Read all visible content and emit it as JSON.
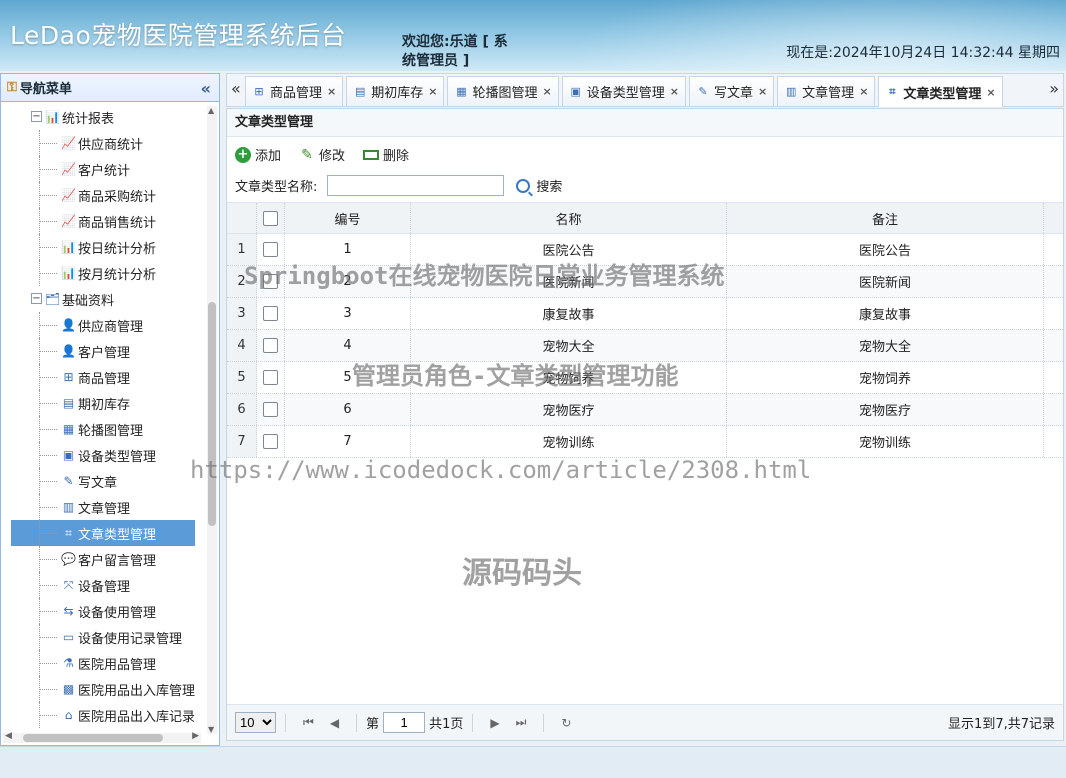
{
  "header": {
    "app_title": "LeDao宠物医院管理系统后台",
    "welcome": "欢迎您:乐道 [ 系统管理员 ]",
    "clock": "现在是:2024年10月24日 14:32:44 星期四"
  },
  "sidebar": {
    "title": "导航菜单",
    "collapse_glyph": "«",
    "items": [
      {
        "type": "group",
        "label": "统计报表",
        "icon": "chart-icon"
      },
      {
        "type": "leaf",
        "label": "供应商统计",
        "icon": "chart-page-icon"
      },
      {
        "type": "leaf",
        "label": "客户统计",
        "icon": "chart-page-icon"
      },
      {
        "type": "leaf",
        "label": "商品采购统计",
        "icon": "chart-page-icon"
      },
      {
        "type": "leaf",
        "label": "商品销售统计",
        "icon": "chart-page-icon"
      },
      {
        "type": "leaf",
        "label": "按日统计分析",
        "icon": "bar-chart-icon"
      },
      {
        "type": "leaf",
        "label": "按月统计分析",
        "icon": "bar-chart-icon"
      },
      {
        "type": "group",
        "label": "基础资料",
        "icon": "folder-icon"
      },
      {
        "type": "leaf",
        "label": "供应商管理",
        "icon": "user-icon"
      },
      {
        "type": "leaf",
        "label": "客户管理",
        "icon": "user-icon"
      },
      {
        "type": "leaf",
        "label": "商品管理",
        "icon": "hierarchy-icon"
      },
      {
        "type": "leaf",
        "label": "期初库存",
        "icon": "inventory-icon"
      },
      {
        "type": "leaf",
        "label": "轮播图管理",
        "icon": "carousel-icon"
      },
      {
        "type": "leaf",
        "label": "设备类型管理",
        "icon": "chip-icon"
      },
      {
        "type": "leaf",
        "label": "写文章",
        "icon": "write-icon"
      },
      {
        "type": "leaf",
        "label": "文章管理",
        "icon": "document-icon"
      },
      {
        "type": "leaf",
        "label": "文章类型管理",
        "icon": "crop-icon",
        "selected": true
      },
      {
        "type": "leaf",
        "label": "客户留言管理",
        "icon": "comment-icon"
      },
      {
        "type": "leaf",
        "label": "设备管理",
        "icon": "expand-icon"
      },
      {
        "type": "leaf",
        "label": "设备使用管理",
        "icon": "flow-icon"
      },
      {
        "type": "leaf",
        "label": "设备使用记录管理",
        "icon": "monitor-icon"
      },
      {
        "type": "leaf",
        "label": "医院用品管理",
        "icon": "flask-icon"
      },
      {
        "type": "leaf",
        "label": "医院用品出入库管理",
        "icon": "grid-icon"
      },
      {
        "type": "leaf",
        "label": "医院用品出入库记录",
        "icon": "building-icon"
      }
    ]
  },
  "tabs": [
    {
      "label": "商品管理",
      "icon": "hierarchy-icon"
    },
    {
      "label": "期初库存",
      "icon": "inventory-icon"
    },
    {
      "label": "轮播图管理",
      "icon": "carousel-icon"
    },
    {
      "label": "设备类型管理",
      "icon": "chip-icon"
    },
    {
      "label": "写文章",
      "icon": "write-icon"
    },
    {
      "label": "文章管理",
      "icon": "document-icon"
    },
    {
      "label": "文章类型管理",
      "icon": "crop-icon",
      "active": true
    }
  ],
  "panel": {
    "title": "文章类型管理",
    "toolbar": {
      "add": "添加",
      "edit": "修改",
      "delete": "删除"
    },
    "search": {
      "label": "文章类型名称:",
      "value": "",
      "button": "搜索"
    },
    "columns": {
      "id": "编号",
      "name": "名称",
      "note": "备注"
    },
    "rows": [
      {
        "rn": "1",
        "id": "1",
        "name": "医院公告",
        "note": "医院公告"
      },
      {
        "rn": "2",
        "id": "2",
        "name": "医院新闻",
        "note": "医院新闻"
      },
      {
        "rn": "3",
        "id": "3",
        "name": "康复故事",
        "note": "康复故事"
      },
      {
        "rn": "4",
        "id": "4",
        "name": "宠物大全",
        "note": "宠物大全"
      },
      {
        "rn": "5",
        "id": "5",
        "name": "宠物饲养",
        "note": "宠物饲养"
      },
      {
        "rn": "6",
        "id": "6",
        "name": "宠物医疗",
        "note": "宠物医疗"
      },
      {
        "rn": "7",
        "id": "7",
        "name": "宠物训练",
        "note": "宠物训练"
      }
    ],
    "pager": {
      "page_size": "10",
      "page_prefix": "第",
      "page": "1",
      "page_suffix": "共1页",
      "info": "显示1到7,共7记录"
    }
  },
  "watermarks": {
    "line1": "Springboot在线宠物医院日常业务管理系统",
    "line2": "管理员角色-文章类型管理功能",
    "line3": "https://www.icodedock.com/article/2308.html",
    "line4": "源码码头"
  }
}
